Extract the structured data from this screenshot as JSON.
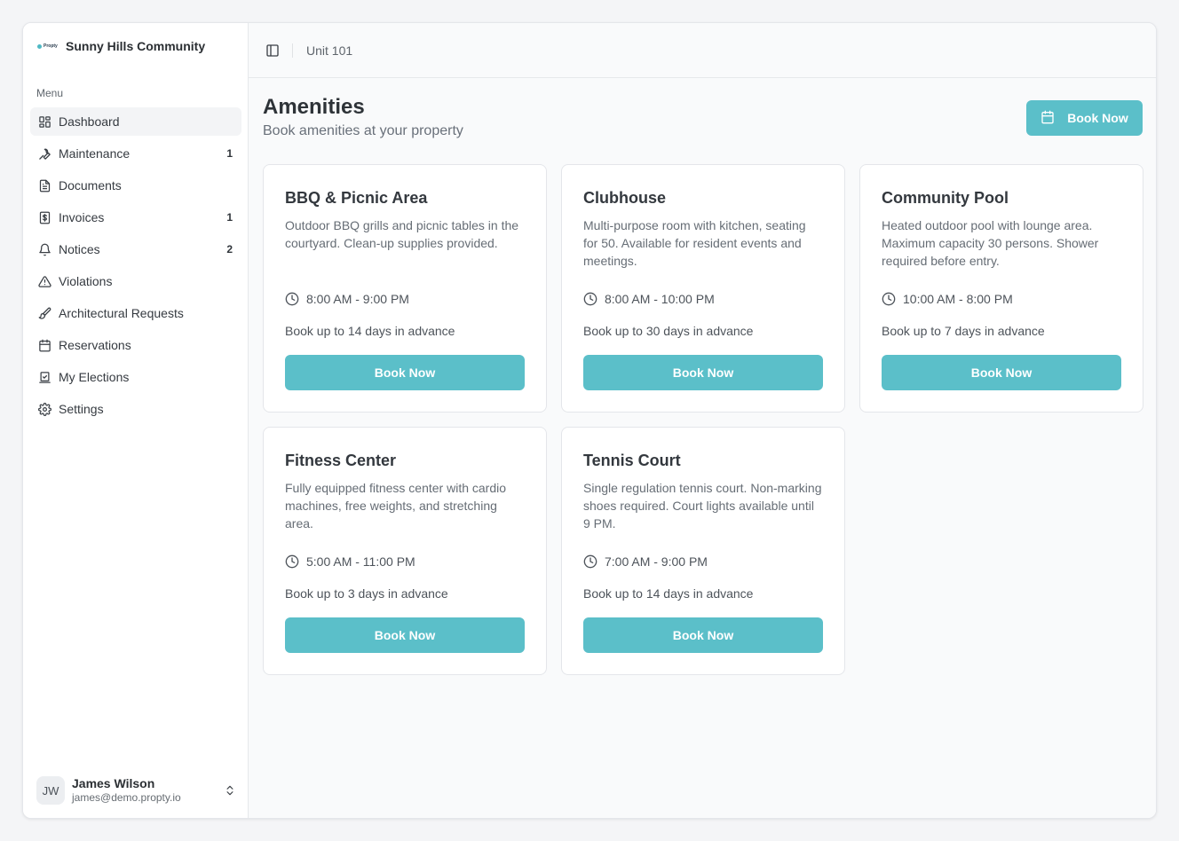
{
  "brand": {
    "name": "Sunny Hills Community",
    "logo_text": "Propty",
    "accent": "#5bbfc9"
  },
  "sidebar": {
    "menu_label": "Menu",
    "items": [
      {
        "label": "Dashboard",
        "icon": "dashboard-icon",
        "badge": ""
      },
      {
        "label": "Maintenance",
        "icon": "wrench-icon",
        "badge": "1"
      },
      {
        "label": "Documents",
        "icon": "document-icon",
        "badge": ""
      },
      {
        "label": "Invoices",
        "icon": "invoice-icon",
        "badge": "1"
      },
      {
        "label": "Notices",
        "icon": "bell-icon",
        "badge": "2"
      },
      {
        "label": "Violations",
        "icon": "warning-icon",
        "badge": ""
      },
      {
        "label": "Architectural Requests",
        "icon": "paintbrush-icon",
        "badge": ""
      },
      {
        "label": "Reservations",
        "icon": "calendar-icon",
        "badge": ""
      },
      {
        "label": "My Elections",
        "icon": "ballot-icon",
        "badge": ""
      },
      {
        "label": "Settings",
        "icon": "gear-icon",
        "badge": ""
      }
    ],
    "user": {
      "initials": "JW",
      "name": "James Wilson",
      "email": "james@demo.propty.io"
    }
  },
  "topbar": {
    "breadcrumb": "Unit 101"
  },
  "page": {
    "title": "Amenities",
    "subtitle": "Book amenities at your property",
    "book_button": "Book Now"
  },
  "amenities": [
    {
      "name": "BBQ & Picnic Area",
      "description": "Outdoor BBQ grills and picnic tables in the courtyard. Clean-up supplies provided.",
      "hours": "8:00 AM - 9:00 PM",
      "advance": "Book up to 14 days in advance",
      "button": "Book Now"
    },
    {
      "name": "Clubhouse",
      "description": "Multi-purpose room with kitchen, seating for 50. Available for resident events and meetings.",
      "hours": "8:00 AM - 10:00 PM",
      "advance": "Book up to 30 days in advance",
      "button": "Book Now"
    },
    {
      "name": "Community Pool",
      "description": "Heated outdoor pool with lounge area. Maximum capacity 30 persons. Shower required before entry.",
      "hours": "10:00 AM - 8:00 PM",
      "advance": "Book up to 7 days in advance",
      "button": "Book Now"
    },
    {
      "name": "Fitness Center",
      "description": "Fully equipped fitness center with cardio machines, free weights, and stretching area.",
      "hours": "5:00 AM - 11:00 PM",
      "advance": "Book up to 3 days in advance",
      "button": "Book Now"
    },
    {
      "name": "Tennis Court",
      "description": "Single regulation tennis court. Non-marking shoes required. Court lights available until 9 PM.",
      "hours": "7:00 AM - 9:00 PM",
      "advance": "Book up to 14 days in advance",
      "button": "Book Now"
    }
  ]
}
